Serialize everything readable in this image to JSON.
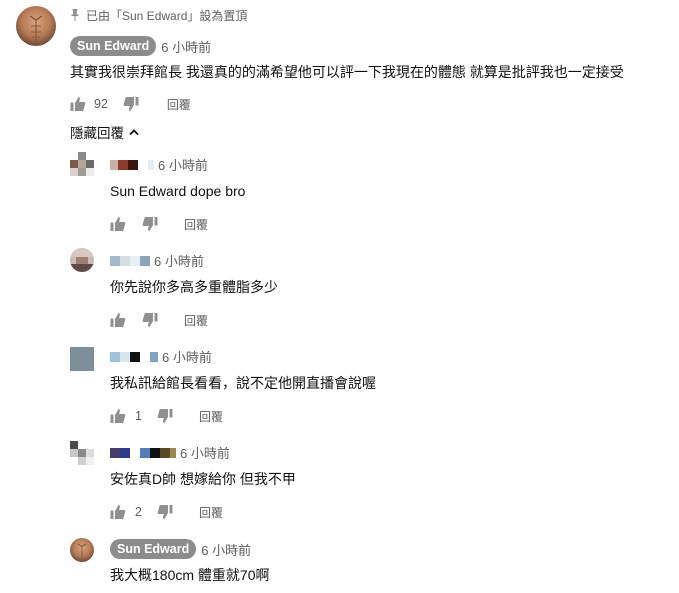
{
  "pinned": {
    "text": "已由「Sun Edward」設為置頂"
  },
  "top_comment": {
    "author": "Sun Edward",
    "time": "6 小時前",
    "text": "其實我很崇拜館長 我還真的的滿希望他可以評一下我現在的體態 就算是批評我也一定接受",
    "likes": "92",
    "reply_label": "回覆"
  },
  "hide_replies_label": "隱藏回覆",
  "replies": [
    {
      "time": "6 小時前",
      "text": "Sun Edward dope bro",
      "likes": "",
      "reply_label": "回覆"
    },
    {
      "time": "6 小時前",
      "text": "你先說你多高多重體脂多少",
      "likes": "",
      "reply_label": "回覆"
    },
    {
      "time": "6 小時前",
      "text": "我私訊給館長看看，說不定他開直播會說喔",
      "likes": "1",
      "reply_label": "回覆"
    },
    {
      "time": "6 小時前",
      "text": "安佐真D帥 想嫁給你 但我不甲",
      "likes": "2",
      "reply_label": "回覆"
    },
    {
      "author": "Sun Edward",
      "time": "6 小時前",
      "text": "我大概180cm 體重就70啊"
    }
  ],
  "colors": {
    "chip_bg": "#8c8c8c",
    "meta_text": "#606060",
    "icon": "#909090"
  },
  "icons": [
    "pin-icon",
    "thumb-up-icon",
    "thumb-down-icon",
    "chevron-up-icon"
  ]
}
